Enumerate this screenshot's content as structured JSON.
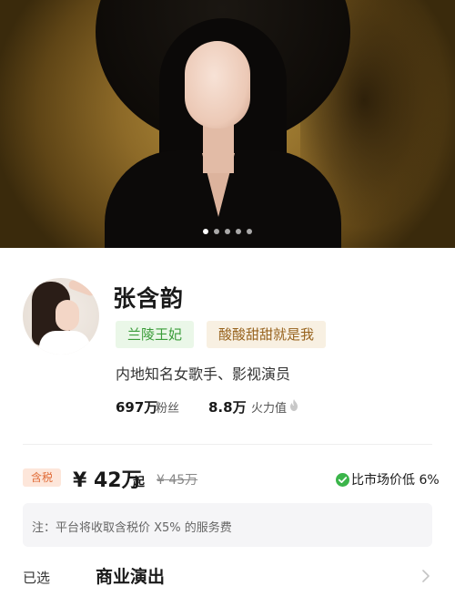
{
  "hero": {
    "slide_count": 5,
    "active_slide": 1
  },
  "profile": {
    "name": "张含韵",
    "tags": [
      "兰陵王妃",
      "酸酸甜甜就是我"
    ],
    "description": "内地知名女歌手、影视演员",
    "stats": {
      "fans_value": "697万",
      "fans_label": "粉丝",
      "heat_value": "8.8万",
      "heat_label": "火力值"
    }
  },
  "price": {
    "tax_badge": "含税",
    "current": "¥ 42万",
    "suffix": "起",
    "original": "¥ 45万",
    "compare_text": "比市场价低 6%"
  },
  "notice": {
    "text": "注：平台将收取含税价 X5% 的服务费"
  },
  "selection": {
    "label": "已选",
    "value": "商业演出"
  },
  "colors": {
    "green_tag_bg": "#eaf7e8",
    "green_tag_text": "#3a9c39",
    "gold_tag_bg": "#f8f0e2",
    "gold_tag_text": "#98641f",
    "tax_badge_bg": "#fde6da",
    "tax_badge_text": "#e06a35",
    "check_green": "#3bb54a"
  }
}
